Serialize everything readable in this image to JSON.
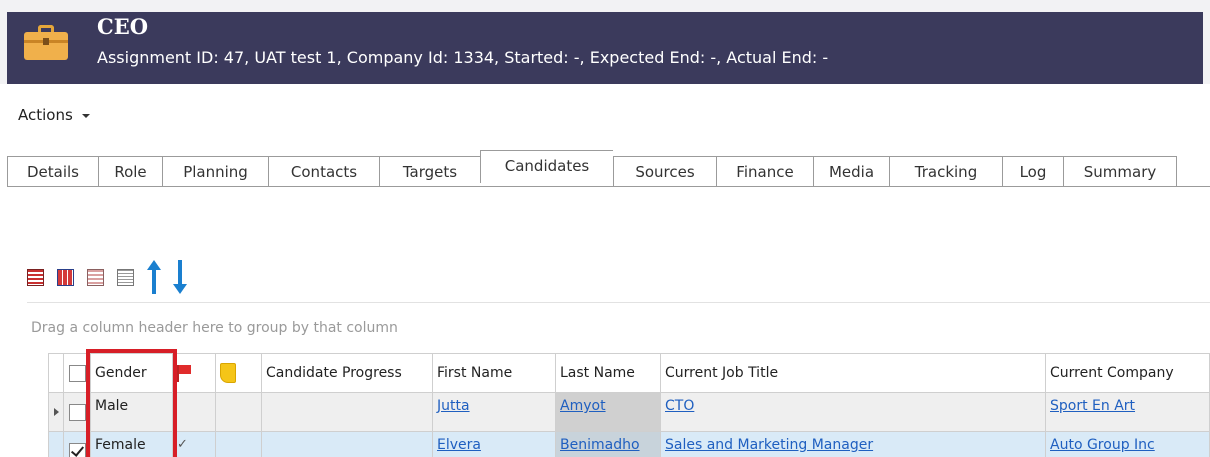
{
  "header": {
    "title": "CEO",
    "subtitle": "Assignment ID: 47, UAT test 1, Company Id: 1334, Started: -, Expected End: -, Actual End: -",
    "icon": "briefcase-icon",
    "bar_color": "#3b3a5c"
  },
  "actions": {
    "label": "Actions"
  },
  "tabs": [
    {
      "label": "Details"
    },
    {
      "label": "Role"
    },
    {
      "label": "Planning"
    },
    {
      "label": "Contacts"
    },
    {
      "label": "Targets"
    },
    {
      "label": "Candidates",
      "active": true
    },
    {
      "label": "Sources"
    },
    {
      "label": "Finance"
    },
    {
      "label": "Media"
    },
    {
      "label": "Tracking"
    },
    {
      "label": "Log"
    },
    {
      "label": "Summary"
    }
  ],
  "toolbar": {
    "icons": [
      "grid-view-icon",
      "card-view-icon",
      "detail-view-icon",
      "list-view-icon",
      "arrow-up-icon",
      "arrow-down-icon"
    ]
  },
  "group_hint": "Drag a column header here to group by that column",
  "grid": {
    "columns": {
      "gender": "Gender",
      "candidate_progress": "Candidate Progress",
      "first_name": "First Name",
      "last_name": "Last Name",
      "job_title": "Current Job Title",
      "company": "Current Company"
    },
    "rows": [
      {
        "gender": "Male",
        "checked": false,
        "flag_tick": "",
        "first_name": "Jutta",
        "last_name": "Amyot",
        "job_title": "CTO",
        "company": "Sport En Art"
      },
      {
        "gender": "Female",
        "checked": true,
        "flag_tick": "✓",
        "first_name": "Elvera",
        "last_name": "Benimadho",
        "job_title": "Sales and Marketing Manager",
        "company": "Auto Group Inc"
      }
    ]
  },
  "colors": {
    "link": "#1f5fc0",
    "highlight": "#d71e27",
    "selected_row": "#d9eaf7"
  }
}
